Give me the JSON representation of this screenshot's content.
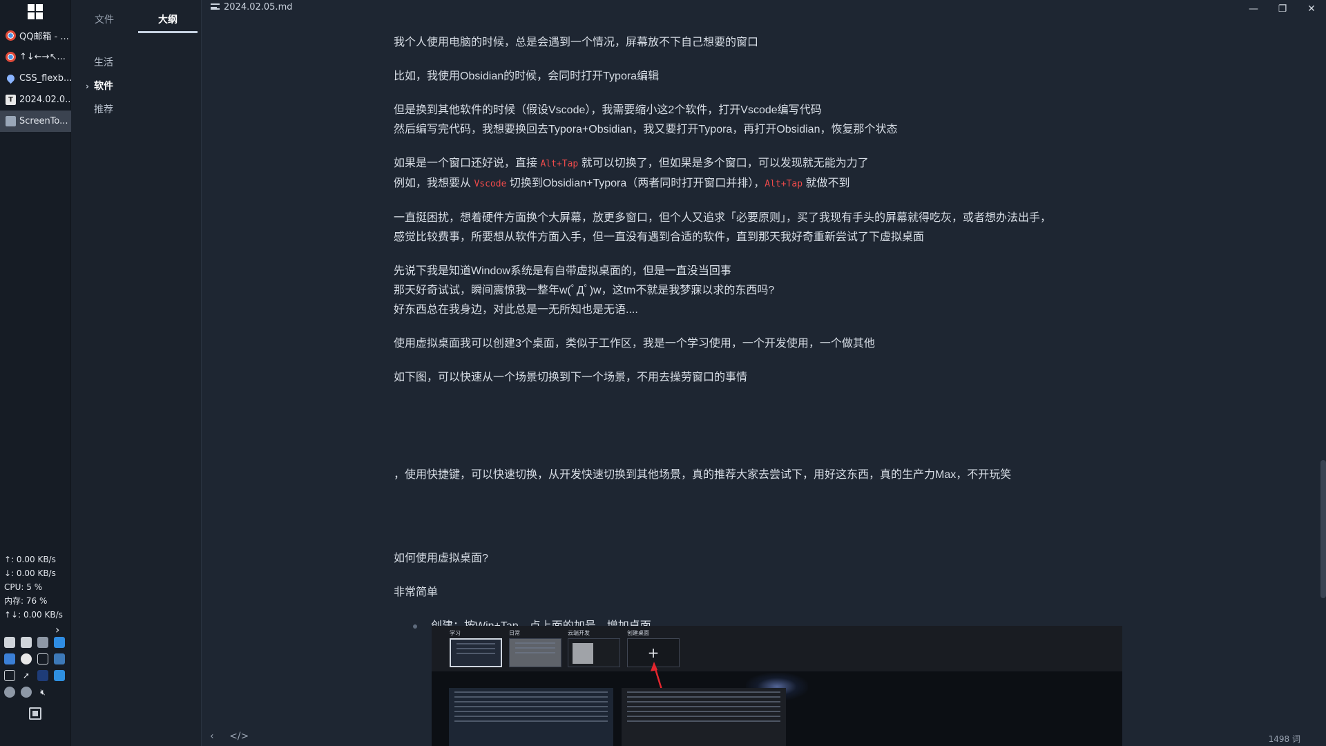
{
  "taskbar": {
    "items": [
      {
        "label": "QQ邮箱 - ...",
        "icon": "chrome-icon"
      },
      {
        "label": "↑↓←→↖...",
        "icon": "chrome-icon"
      },
      {
        "label": "CSS_flexb...",
        "icon": "drop-icon"
      },
      {
        "label": "2024.02.0...",
        "icon": "typora-icon"
      },
      {
        "label": "ScreenTo...",
        "icon": "screen-icon"
      }
    ],
    "stats": {
      "up": "↑: 0.00 KB/s",
      "down": "↓: 0.00 KB/s",
      "cpu": "CPU: 5 %",
      "mem": "内存: 76 %",
      "total": "↑↓: 0.00 KB/s"
    }
  },
  "sidebar": {
    "tabs": {
      "files": "文件",
      "outline": "大纲"
    },
    "outline": [
      {
        "label": "生活"
      },
      {
        "label": "软件",
        "caret": "›"
      },
      {
        "label": "推荐"
      }
    ]
  },
  "titlebar": {
    "filename": "2024.02.05.md"
  },
  "content": {
    "p1": "我个人使用电脑的时候，总是会遇到一个情况，屏幕放不下自己想要的窗口",
    "p2": "比如，我使用Obsidian的时候，会同时打开Typora编辑",
    "p3a": "但是换到其他软件的时候（假设Vscode），我需要缩小这2个软件，打开Vscode编写代码",
    "p3b": "然后编写完代码，我想要换回去Typora+Obsidian，我又要打开Typora，再打开Obsidian，恢复那个状态",
    "p4a_1": "如果是一个窗口还好说，直接 ",
    "p4a_code": "Alt+Tap",
    "p4a_2": " 就可以切换了，但如果是多个窗口，可以发现就无能为力了",
    "p4b_1": "例如，我想要从 ",
    "p4b_code1": "Vscode",
    "p4b_2": " 切换到Obsidian+Typora（两者同时打开窗口并排），",
    "p4b_code2": "Alt+Tap",
    "p4b_3": " 就做不到",
    "p5a": "一直挺困扰，想着硬件方面换个大屏幕，放更多窗口，但个人又追求「必要原则」，买了我现有手头的屏幕就得吃灰，或者想办法出手，",
    "p5b": "感觉比较费事，所要想从软件方面入手，但一直没有遇到合适的软件，直到那天我好奇重新尝试了下虚拟桌面",
    "p6a": "先说下我是知道Window系统是有自带虚拟桌面的，但是一直没当回事",
    "p6b": "那天好奇试试，瞬间震惊我一整年w(ﾟДﾟ)w，这tm不就是我梦寐以求的东西吗?",
    "p6c": "好东西总在我身边，对此总是一无所知也是无语....",
    "p7": "使用虚拟桌面我可以创建3个桌面，类似于工作区，我是一个学习使用，一个开发使用，一个做其他",
    "p8": "如下图，可以快速从一个场景切换到下一个场景，不用去操劳窗口的事情",
    "p9": "，使用快捷键，可以快速切换，从开发快速切换到其他场景，真的推荐大家去尝试下，用好这东西，真的生产力Max，不开玩笑",
    "p10": "如何使用虚拟桌面?",
    "p11": "非常简单",
    "step1": "创建：按Win+Tap，点上面的加号，增加桌面"
  },
  "embed": {
    "desktops": [
      "学习",
      "日常",
      "云端开发",
      "创建桌面"
    ],
    "add": "+"
  },
  "status": {
    "back": "‹",
    "source": "</>",
    "words": "1498 词"
  },
  "window": {
    "minimize": "—",
    "restore": "❐",
    "close": "✕"
  },
  "tray": {
    "chevron": "›"
  }
}
